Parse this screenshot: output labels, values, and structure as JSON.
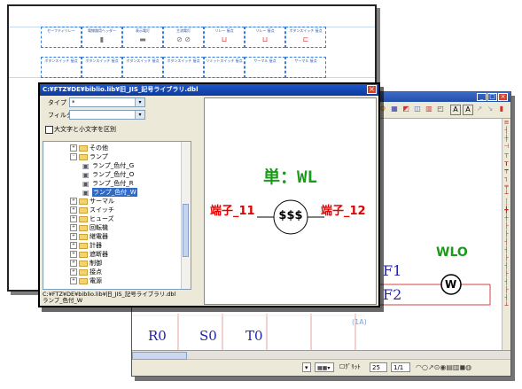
{
  "sheet": {
    "row1_labels": [
      "セーフティリレー",
      "電線路用ヘッダー",
      "表示電灯",
      "主流電灯",
      "リレー 接点",
      "リレー 接点",
      "ボタンスイッチ 接点"
    ],
    "row2_labels": [
      "ボタンスイッチ 接点",
      "ボタンスイッチ 接点",
      "ボタンスイッチ 接点",
      "ボタンスイッチ 接点",
      "リミットスイッチ 接点",
      "サーマル 接点",
      "サーマル 接点"
    ]
  },
  "library": {
    "title": "C:¥FTZ¥DE¥biblio.lib¥旧_JIS_記号ライブラリ.dbl",
    "type_label": "タイプ",
    "type_value": "*",
    "filter_label": "フィルタ",
    "filter_value": "",
    "case_label": "大文字と小文字を区別",
    "tree": [
      {
        "label": "その他",
        "kind": "folder",
        "indent": 1,
        "exp": "+"
      },
      {
        "label": "ランプ",
        "kind": "folder",
        "indent": 1,
        "exp": "-"
      },
      {
        "label": "ランプ_色付_G",
        "kind": "item",
        "indent": 2
      },
      {
        "label": "ランプ_色付_O",
        "kind": "item",
        "indent": 2
      },
      {
        "label": "ランプ_色付_R",
        "kind": "item",
        "indent": 2
      },
      {
        "label": "ランプ_色付_W",
        "kind": "item",
        "indent": 2,
        "selected": true
      },
      {
        "label": "サーマル",
        "kind": "folder",
        "indent": 1,
        "exp": "+"
      },
      {
        "label": "スイッチ",
        "kind": "folder",
        "indent": 1,
        "exp": "+"
      },
      {
        "label": "ヒューズ",
        "kind": "folder",
        "indent": 1,
        "exp": "+"
      },
      {
        "label": "回転機",
        "kind": "folder",
        "indent": 1,
        "exp": "+"
      },
      {
        "label": "継電器",
        "kind": "folder",
        "indent": 1,
        "exp": "+"
      },
      {
        "label": "計器",
        "kind": "folder",
        "indent": 1,
        "exp": "+"
      },
      {
        "label": "遮断器",
        "kind": "folder",
        "indent": 1,
        "exp": "+"
      },
      {
        "label": "制御",
        "kind": "folder",
        "indent": 1,
        "exp": "+"
      },
      {
        "label": "接点",
        "kind": "folder",
        "indent": 1,
        "exp": "+"
      },
      {
        "label": "電源",
        "kind": "folder",
        "indent": 1,
        "exp": "+"
      }
    ],
    "path_line1": "C:¥FTZ¥DE¥biblio.lib¥旧_JIS_記号ライブラリ.dbl",
    "path_line2": "ランプ_色付_W",
    "preview": {
      "heading": "単：WL",
      "left_terminal": "端子_11",
      "right_terminal": "端子_12",
      "center": "$$$"
    }
  },
  "cad": {
    "labels": {
      "f1": "F1",
      "f2": "F2",
      "r0": "R0",
      "s0": "S0",
      "t0": "T0",
      "wlo": "WLO",
      "lamp": "W",
      "sub": "(1A)"
    },
    "status": {
      "page": "25",
      "pages": "1/1",
      "grid_label": "ｸﾞﾘｯﾄ"
    }
  },
  "colors": {
    "title_blue": "#0b3a9e",
    "green": "#1a9b1a",
    "red": "#e00000",
    "cad_blue": "#1f1fb0"
  }
}
